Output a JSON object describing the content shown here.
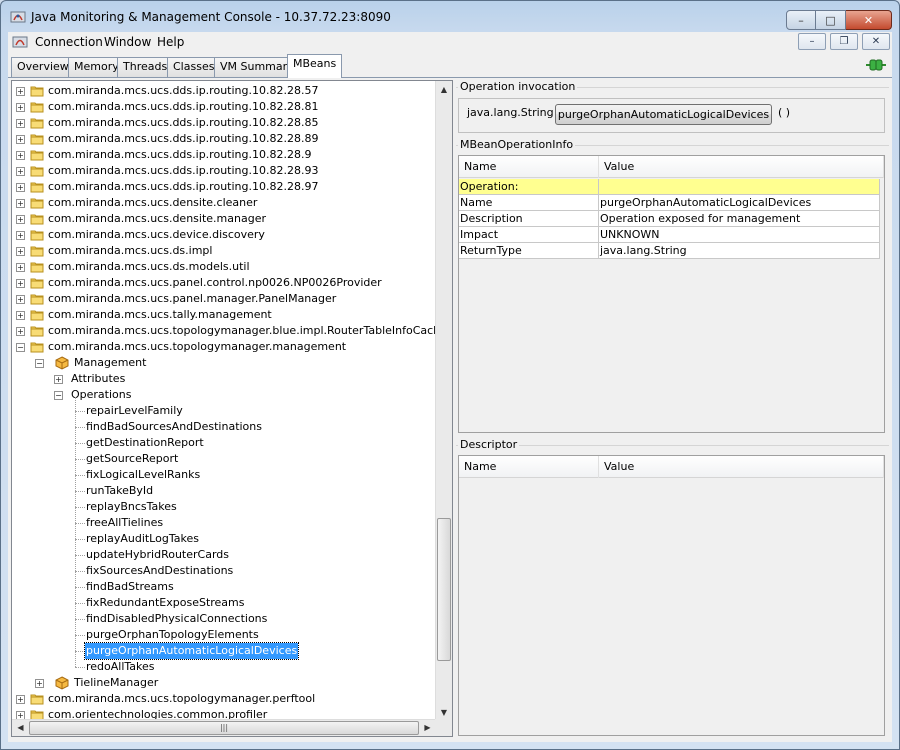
{
  "window": {
    "title": "Java Monitoring & Management Console - 10.37.72.23:8090",
    "controls": {
      "minimize": "–",
      "maximize": "□",
      "close": "✕"
    }
  },
  "menubar": {
    "items": [
      "Connection",
      "Window",
      "Help"
    ],
    "mdi_controls": {
      "minimize": "–",
      "restore": "❐",
      "close": "✕"
    }
  },
  "tabs": [
    "Overview",
    "Memory",
    "Threads",
    "Classes",
    "VM Summary",
    "MBeans"
  ],
  "active_tab": "MBeans",
  "tree": {
    "domains_top": [
      "com.miranda.mcs.ucs.dds.ip.routing.10.82.28.57",
      "com.miranda.mcs.ucs.dds.ip.routing.10.82.28.81",
      "com.miranda.mcs.ucs.dds.ip.routing.10.82.28.85",
      "com.miranda.mcs.ucs.dds.ip.routing.10.82.28.89",
      "com.miranda.mcs.ucs.dds.ip.routing.10.82.28.9",
      "com.miranda.mcs.ucs.dds.ip.routing.10.82.28.93",
      "com.miranda.mcs.ucs.dds.ip.routing.10.82.28.97",
      "com.miranda.mcs.ucs.densite.cleaner",
      "com.miranda.mcs.ucs.densite.manager",
      "com.miranda.mcs.ucs.device.discovery",
      "com.miranda.mcs.ucs.ds.impl",
      "com.miranda.mcs.ucs.ds.models.util",
      "com.miranda.mcs.ucs.panel.control.np0026.NP0026Provider",
      "com.miranda.mcs.ucs.panel.manager.PanelManager",
      "com.miranda.mcs.ucs.tally.management",
      "com.miranda.mcs.ucs.topologymanager.blue.impl.RouterTableInfoCacheManager"
    ],
    "expanded_domain": "com.miranda.mcs.ucs.topologymanager.management",
    "mbean": "Management",
    "attributes_label": "Attributes",
    "operations_label": "Operations",
    "operations": [
      "repairLevelFamily",
      "findBadSourcesAndDestinations",
      "getDestinationReport",
      "getSourceReport",
      "fixLogicalLevelRanks",
      "runTakeById",
      "replayBncsTakes",
      "freeAllTielines",
      "replayAuditLogTakes",
      "updateHybridRouterCards",
      "fixSourcesAndDestinations",
      "findBadStreams",
      "fixRedundantExposeStreams",
      "findDisabledPhysicalConnections",
      "purgeOrphanTopologyElements",
      "purgeOrphanAutomaticLogicalDevices",
      "redoAllTakes"
    ],
    "selected_operation": "purgeOrphanAutomaticLogicalDevices",
    "second_mbean": "TielineManager",
    "domains_bottom": [
      "com.miranda.mcs.ucs.topologymanager.perftool",
      "com.orientechnologies.common.profiler"
    ],
    "hscroll_grip": "|||"
  },
  "invocation": {
    "title": "Operation invocation",
    "return_type": "java.lang.String",
    "button_label": "purgeOrphanAutomaticLogicalDevices",
    "parens": "( )"
  },
  "opinfo": {
    "title": "MBeanOperationInfo",
    "headers": [
      "Name",
      "Value"
    ],
    "rows": [
      {
        "name": "Operation:",
        "value": ""
      },
      {
        "name": "Name",
        "value": "purgeOrphanAutomaticLogicalDevices"
      },
      {
        "name": "Description",
        "value": "Operation exposed for management"
      },
      {
        "name": "Impact",
        "value": "UNKNOWN"
      },
      {
        "name": "ReturnType",
        "value": "java.lang.String"
      }
    ]
  },
  "descriptor": {
    "title": "Descriptor",
    "headers": [
      "Name",
      "Value"
    ]
  },
  "colors": {
    "selection": "#3399ff",
    "highlight_row": "#ffff90",
    "frame": "#c7d9ee"
  }
}
